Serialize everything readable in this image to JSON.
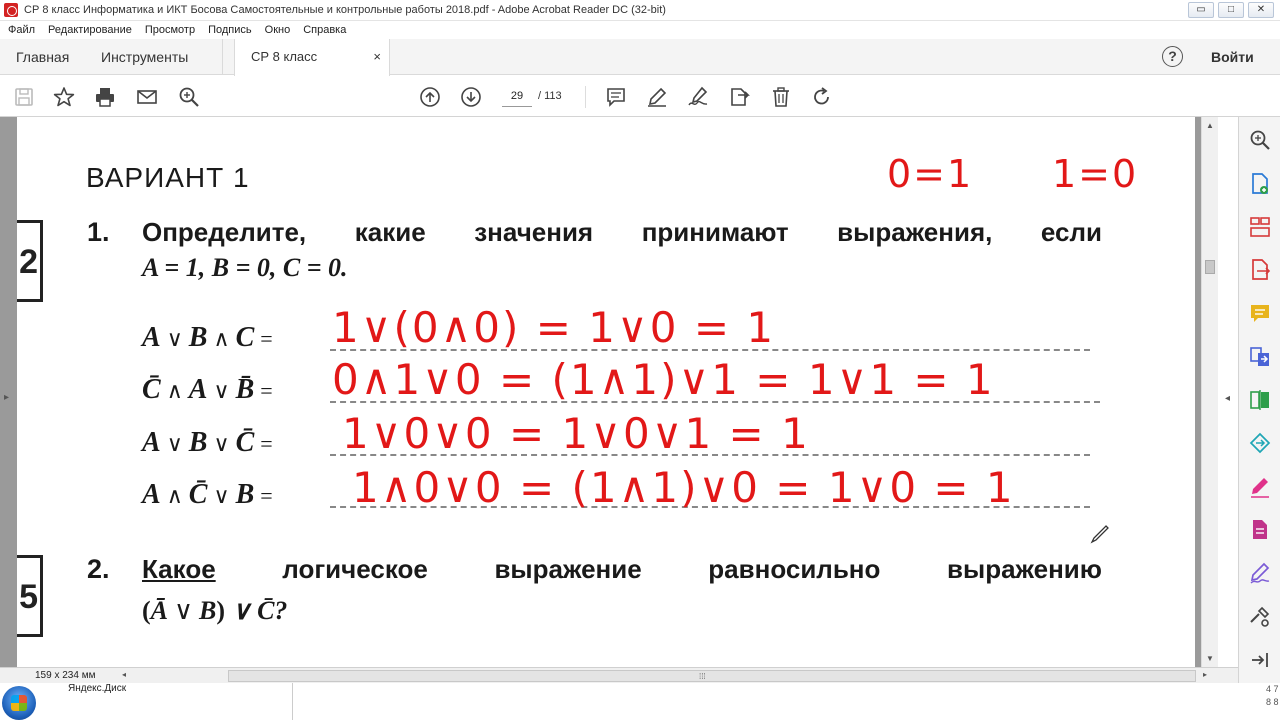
{
  "window": {
    "title": "СР 8 класс Информатика и ИКТ Босова Самостоятельные и контрольные работы 2018.pdf - Adobe Acrobat Reader DC (32-bit)",
    "controls": [
      "▭",
      "□",
      "✕"
    ]
  },
  "menu": [
    "Файл",
    "Редактирование",
    "Просмотр",
    "Подпись",
    "Окно",
    "Справка"
  ],
  "tabs": {
    "home": "Главная",
    "tools": "Инструменты",
    "document": "СР 8 класс Инфор...",
    "close": "×"
  },
  "help": "?",
  "signin": "Войти",
  "toolbar": {
    "page_current": "29",
    "page_total": "/ 113"
  },
  "page": {
    "variant": "ВАРИАНТ 1",
    "box1_number": "2",
    "box2_number": "5",
    "task1": {
      "number": "1.",
      "words": [
        "Определите,",
        "какие",
        "значения",
        "принимают",
        "выражения,",
        "если"
      ],
      "condition": "A = 1, B = 0, C = 0."
    },
    "expressions": [
      {
        "parts": [
          "A",
          "∨",
          "B",
          "∧",
          "C",
          "="
        ]
      },
      {
        "parts": [
          "C̄",
          "∧",
          "A",
          "∨",
          "B̄",
          "="
        ]
      },
      {
        "parts": [
          "A",
          "∨",
          "B",
          "∨",
          "C̄",
          "="
        ]
      },
      {
        "parts": [
          "A",
          "∧",
          "C̄",
          "∨",
          "B",
          "="
        ]
      }
    ],
    "handwriting": {
      "top_note_1": "0=1",
      "top_note_2": "1=0",
      "answer1": "1∨(0∧0) = 1∨0 = 1",
      "answer2": "0∧1∨0 = (1∧1)∨1 = 1∨1 = 1",
      "answer3": "1∨0∨0 = 1∨0∨1 = 1",
      "answer4": "1∧0∨0 = (1∧1)∨0 = 1∨0 = 1"
    },
    "task2": {
      "number": "2.",
      "words": [
        "Какое",
        "логическое",
        "выражение",
        "равносильно",
        "выражению"
      ],
      "expression_end": "∨ C̄?"
    }
  },
  "status": {
    "dimensions": "159 x 234 мм"
  },
  "taskbar": {
    "item": "Яндекс.Диск",
    "tray": "4 7\n8 8"
  },
  "colors": {
    "ink": "#e21818",
    "accent_icons": [
      "#e0328a",
      "#2a7ad6",
      "#d63a3a",
      "#e8b41c",
      "#4a64d6",
      "#2e9e4a",
      "#1fa6b5",
      "#c0338a",
      "#7b5bd6"
    ]
  }
}
